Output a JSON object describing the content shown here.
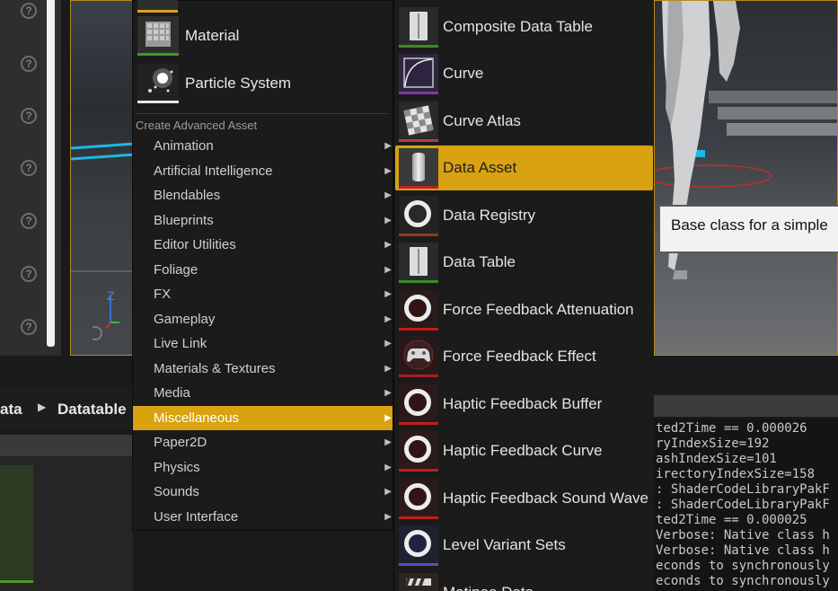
{
  "basic_assets": [
    {
      "label": "Material",
      "icon": "material-icon"
    },
    {
      "label": "Particle System",
      "icon": "particle-system-icon"
    }
  ],
  "menu": {
    "section_label": "Create Advanced Asset",
    "categories": [
      "Animation",
      "Artificial Intelligence",
      "Blendables",
      "Blueprints",
      "Editor Utilities",
      "Foliage",
      "FX",
      "Gameplay",
      "Live Link",
      "Materials & Textures",
      "Media",
      "Miscellaneous",
      "Paper2D",
      "Physics",
      "Sounds",
      "User Interface"
    ],
    "active_category": "Miscellaneous"
  },
  "submenu": {
    "items": [
      {
        "label": "Composite Data Table",
        "icon": "composite-data-table-icon"
      },
      {
        "label": "Curve",
        "icon": "curve-icon"
      },
      {
        "label": "Curve Atlas",
        "icon": "curve-atlas-icon"
      },
      {
        "label": "Data Asset",
        "icon": "data-asset-icon"
      },
      {
        "label": "Data Registry",
        "icon": "data-registry-icon"
      },
      {
        "label": "Data Table",
        "icon": "data-table-icon"
      },
      {
        "label": "Force Feedback Attenuation",
        "icon": "force-feedback-attenuation-icon"
      },
      {
        "label": "Force Feedback Effect",
        "icon": "gamepad-icon"
      },
      {
        "label": "Haptic Feedback Buffer",
        "icon": "haptic-feedback-buffer-icon"
      },
      {
        "label": "Haptic Feedback Curve",
        "icon": "haptic-feedback-curve-icon"
      },
      {
        "label": "Haptic Feedback Sound Wave",
        "icon": "haptic-feedback-sound-wave-icon"
      },
      {
        "label": "Level Variant Sets",
        "icon": "level-variant-sets-icon"
      },
      {
        "label": "Matinee Data",
        "icon": "clapperboard-icon"
      }
    ],
    "active_item": "Data Asset"
  },
  "tooltip": {
    "text": "Base class for a simple"
  },
  "breadcrumb": {
    "first": "ata",
    "second": "Datatable"
  },
  "viewport": {
    "axis_z": "Z"
  },
  "log": {
    "lines": [
      "ted2Time == 0.000026",
      "ryIndexSize=192",
      "ashIndexSize=101",
      "irectoryIndexSize=158",
      ": ShaderCodeLibraryPakF",
      ": ShaderCodeLibraryPakF",
      "ted2Time == 0.000025",
      "Verbose: Native class h",
      "Verbose: Native class h",
      "econds to synchronously",
      "econds to synchronously"
    ]
  },
  "colors": {
    "highlight": "#d8a210",
    "menu_bg": "#1b1b1b",
    "tooltip_bg": "#f2f2f2"
  }
}
